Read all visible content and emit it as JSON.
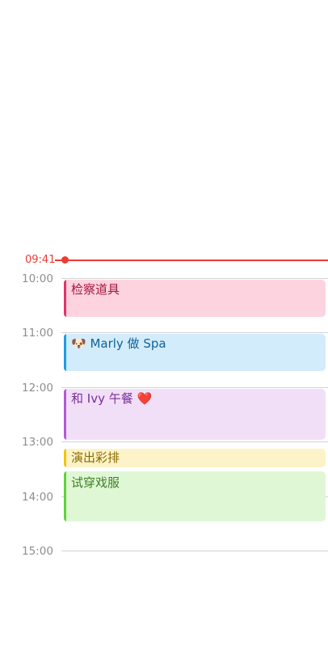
{
  "now": {
    "time_label": "09:41"
  },
  "hours": [
    "10:00",
    "11:00",
    "12:00",
    "13:00",
    "14:00",
    "15:00"
  ],
  "events": [
    {
      "title": "检察道具",
      "bg": "#fdd3df",
      "bar": "#e3326d",
      "text": "#a3173f"
    },
    {
      "title": "🐶 Marly 做 Spa",
      "bg": "#d3ecfb",
      "bar": "#1c9ee6",
      "text": "#11629b"
    },
    {
      "title": "和 Ivy 午餐 ❤️",
      "bg": "#f1dff8",
      "bar": "#b35ad6",
      "text": "#7b2e99"
    },
    {
      "title": "演出彩排",
      "bg": "#fdf3c8",
      "bar": "#f5c40a",
      "text": "#8a6b00"
    },
    {
      "title": "试穿戏服",
      "bg": "#e0f7d6",
      "bar": "#5fd33b",
      "text": "#3c8023"
    }
  ]
}
